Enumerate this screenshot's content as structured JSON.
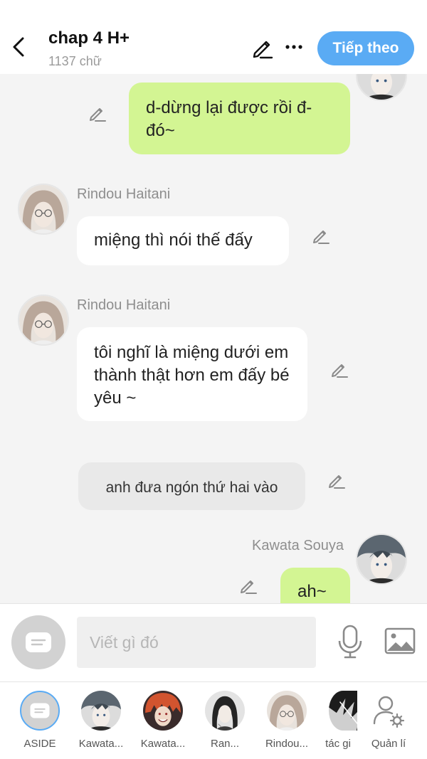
{
  "header": {
    "title": "chap 4 H+",
    "word_count": "1137 chữ",
    "next_label": "Tiếp theo"
  },
  "messages": [
    {
      "side": "right",
      "text": "d-dừng lại được rồi đ-đó~"
    },
    {
      "side": "left",
      "sender": "Rindou Haitani",
      "text": "miệng thì nói thế đấy"
    },
    {
      "side": "left",
      "sender": "Rindou Haitani",
      "text": "tôi nghĩ là miệng dưới em thành thật hơn em đấy bé yêu ~"
    },
    {
      "side": "narration",
      "text": "anh đưa ngón thứ hai vào"
    },
    {
      "side": "right",
      "sender": "Kawata Souya",
      "text": "ah~"
    }
  ],
  "composer": {
    "placeholder": "Viết gì đó"
  },
  "characters": [
    {
      "label": "ASIDE"
    },
    {
      "label": "Kawata..."
    },
    {
      "label": "Kawata..."
    },
    {
      "label": "Ran..."
    },
    {
      "label": "Rindou..."
    },
    {
      "label": "tác gi"
    },
    {
      "label": "Quản lí"
    }
  ],
  "colors": {
    "accent": "#5aabf4",
    "right_bubble": "#d3f593",
    "left_bubble": "#ffffff",
    "narration_bubble": "#e9e9e9"
  }
}
